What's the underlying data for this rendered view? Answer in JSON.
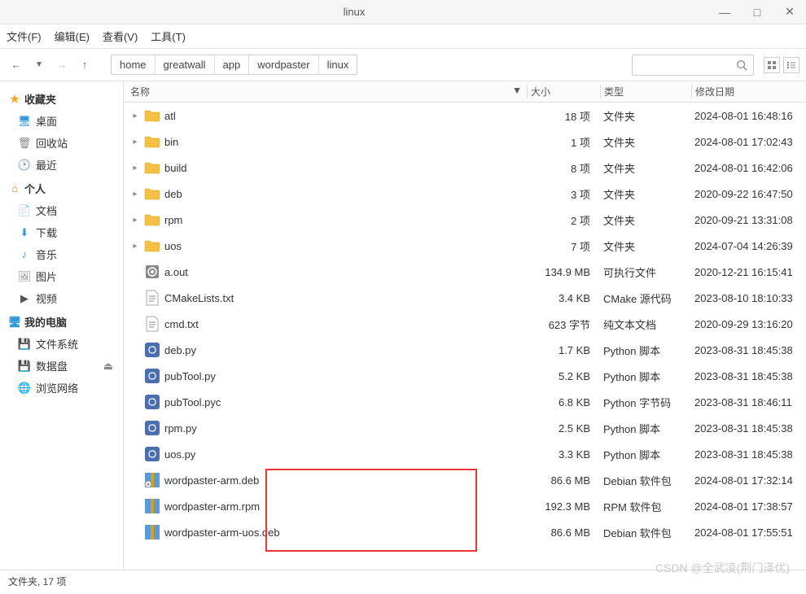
{
  "window": {
    "title": "linux"
  },
  "menu": {
    "file": "文件(F)",
    "edit": "编辑(E)",
    "view": "查看(V)",
    "tool": "工具(T)"
  },
  "breadcrumb": [
    "home",
    "greatwall",
    "app",
    "wordpaster",
    "linux"
  ],
  "sidebar": {
    "favorites": {
      "title": "收藏夹",
      "items": [
        {
          "label": "桌面",
          "icon": "desktop"
        },
        {
          "label": "回收站",
          "icon": "trash"
        },
        {
          "label": "最近",
          "icon": "recent"
        }
      ]
    },
    "personal": {
      "title": "个人",
      "items": [
        {
          "label": "文档",
          "icon": "doc"
        },
        {
          "label": "下载",
          "icon": "download"
        },
        {
          "label": "音乐",
          "icon": "music"
        },
        {
          "label": "图片",
          "icon": "picture"
        },
        {
          "label": "视频",
          "icon": "video"
        }
      ]
    },
    "computer": {
      "title": "我的电脑",
      "items": [
        {
          "label": "文件系统",
          "icon": "disk"
        },
        {
          "label": "数据盘",
          "icon": "disk",
          "eject": true
        },
        {
          "label": "浏览网络",
          "icon": "network"
        }
      ]
    }
  },
  "columns": {
    "name": "名称",
    "sort": "▼",
    "size": "大小",
    "type": "类型",
    "date": "修改日期"
  },
  "files": [
    {
      "name": "atl",
      "size": "18 项",
      "type": "文件夹",
      "date": "2024-08-01 16:48:16",
      "icon": "folder",
      "expandable": true
    },
    {
      "name": "bin",
      "size": "1 项",
      "type": "文件夹",
      "date": "2024-08-01 17:02:43",
      "icon": "folder",
      "expandable": true
    },
    {
      "name": "build",
      "size": "8 项",
      "type": "文件夹",
      "date": "2024-08-01 16:42:06",
      "icon": "folder",
      "expandable": true
    },
    {
      "name": "deb",
      "size": "3 项",
      "type": "文件夹",
      "date": "2020-09-22 16:47:50",
      "icon": "folder",
      "expandable": true
    },
    {
      "name": "rpm",
      "size": "2 项",
      "type": "文件夹",
      "date": "2020-09-21 13:31:08",
      "icon": "folder",
      "expandable": true
    },
    {
      "name": "uos",
      "size": "7 项",
      "type": "文件夹",
      "date": "2024-07-04 14:26:39",
      "icon": "folder",
      "expandable": true
    },
    {
      "name": "a.out",
      "size": "134.9 MB",
      "type": "可执行文件",
      "date": "2020-12-21 16:15:41",
      "icon": "exec"
    },
    {
      "name": "CMakeLists.txt",
      "size": "3.4 KB",
      "type": "CMake 源代码",
      "date": "2023-08-10 18:10:33",
      "icon": "text"
    },
    {
      "name": "cmd.txt",
      "size": "623 字节",
      "type": "纯文本文档",
      "date": "2020-09-29 13:16:20",
      "icon": "text"
    },
    {
      "name": "deb.py",
      "size": "1.7 KB",
      "type": "Python 脚本",
      "date": "2023-08-31 18:45:38",
      "icon": "python"
    },
    {
      "name": "pubTool.py",
      "size": "5.2 KB",
      "type": "Python 脚本",
      "date": "2023-08-31 18:45:38",
      "icon": "python"
    },
    {
      "name": "pubTool.pyc",
      "size": "6.8 KB",
      "type": "Python 字节码",
      "date": "2023-08-31 18:46:11",
      "icon": "python"
    },
    {
      "name": "rpm.py",
      "size": "2.5 KB",
      "type": "Python 脚本",
      "date": "2023-08-31 18:45:38",
      "icon": "python"
    },
    {
      "name": "uos.py",
      "size": "3.3 KB",
      "type": "Python 脚本",
      "date": "2023-08-31 18:45:38",
      "icon": "python"
    },
    {
      "name": "wordpaster-arm.deb",
      "size": "86.6 MB",
      "type": "Debian 软件包",
      "date": "2024-08-01 17:32:14",
      "icon": "package",
      "lock": true
    },
    {
      "name": "wordpaster-arm.rpm",
      "size": "192.3 MB",
      "type": "RPM 软件包",
      "date": "2024-08-01 17:38:57",
      "icon": "package"
    },
    {
      "name": "wordpaster-arm-uos.deb",
      "size": "86.6 MB",
      "type": "Debian 软件包",
      "date": "2024-08-01 17:55:51",
      "icon": "package"
    }
  ],
  "status": "文件夹, 17 项",
  "watermark": "CSDN @全武凌(荆门泽优)"
}
